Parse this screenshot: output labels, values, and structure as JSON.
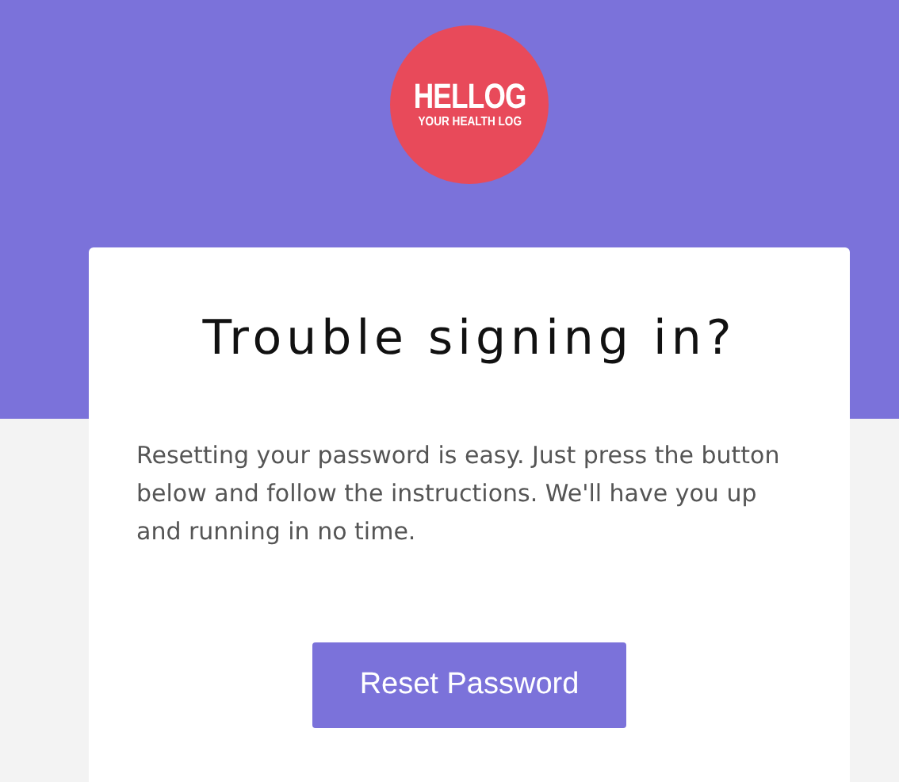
{
  "logo": {
    "name": "HELLOG",
    "tagline": "YOUR HEALTH LOG"
  },
  "card": {
    "title": "Trouble signing in?",
    "message": "Resetting your password is easy. Just press the button below and follow the instructions. We'll have you up and running in no time.",
    "button": "Reset Password"
  }
}
